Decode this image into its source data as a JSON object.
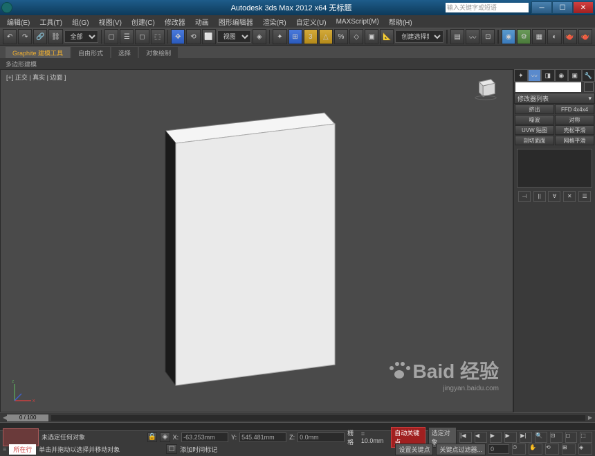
{
  "title": "Autodesk 3ds Max 2012 x64   无标题",
  "search_placeholder": "输入关键字或短语",
  "menus": [
    "编辑(E)",
    "工具(T)",
    "组(G)",
    "视图(V)",
    "创建(C)",
    "修改器",
    "动画",
    "图形编辑器",
    "渲染(R)",
    "自定义(U)",
    "MAXScript(M)",
    "帮助(H)"
  ],
  "toolbar1": {
    "select_filter": "全部",
    "view_label": "视图",
    "create_selection": "创建选择集"
  },
  "ribbon": {
    "tabs": [
      "Graphite 建模工具",
      "自由形式",
      "选择",
      "对象绘制"
    ],
    "panel": "多边形建模"
  },
  "viewport": {
    "label": "[+] 正交 | 真实 | 边面 ]"
  },
  "cmd_panel": {
    "rollout_title": "修改器列表",
    "buttons": [
      "挤出",
      "FFD 4x4x4",
      "噪波",
      "对称",
      "UVW 贴图",
      "壳松平滑",
      "剖切面面",
      "网格平滑"
    ]
  },
  "timeline": {
    "slider": "0 / 100"
  },
  "status": {
    "prompt1": "未选定任何对象",
    "prompt2": "单击并拖动以选择并移动对象",
    "x": "-63.253mm",
    "y": "545.481mm",
    "z": "0.0mm",
    "grid_label": "栅格",
    "grid_val": "= 10.0mm",
    "auto_key": "自动关键点",
    "sel_lock": "选定对象",
    "add_time_tag": "添加时间标记",
    "set_key": "设置关键点",
    "key_filter": "关键点过滤器...",
    "now_running": "所在行"
  },
  "watermark": "Baid 经验",
  "watermark_url": "jingyan.baidu.com"
}
